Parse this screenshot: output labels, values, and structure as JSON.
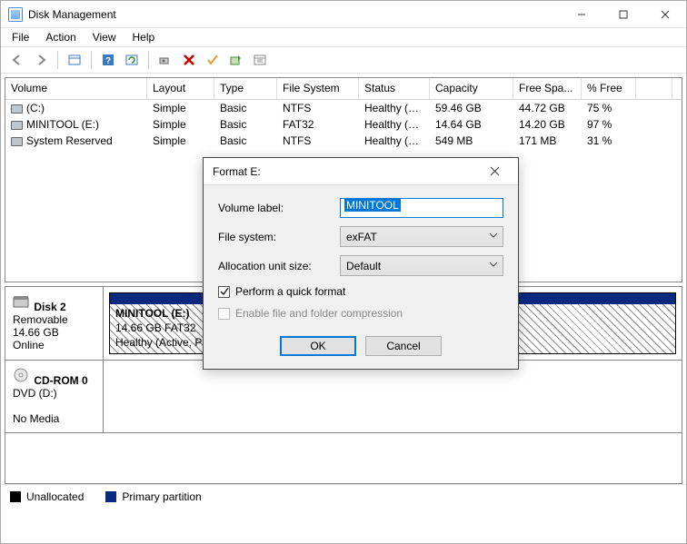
{
  "window": {
    "title": "Disk Management"
  },
  "menu": {
    "file": "File",
    "action": "Action",
    "view": "View",
    "help": "Help"
  },
  "columns": [
    "Volume",
    "Layout",
    "Type",
    "File System",
    "Status",
    "Capacity",
    "Free Spa...",
    "% Free"
  ],
  "volumes": [
    {
      "name": "(C:)",
      "layout": "Simple",
      "type": "Basic",
      "fs": "NTFS",
      "status": "Healthy (B...",
      "capacity": "59.46 GB",
      "free": "44.72 GB",
      "pct": "75 %"
    },
    {
      "name": "MINITOOL (E:)",
      "layout": "Simple",
      "type": "Basic",
      "fs": "FAT32",
      "status": "Healthy (A...",
      "capacity": "14.64 GB",
      "free": "14.20 GB",
      "pct": "97 %"
    },
    {
      "name": "System Reserved",
      "layout": "Simple",
      "type": "Basic",
      "fs": "NTFS",
      "status": "Healthy (S...",
      "capacity": "549 MB",
      "free": "171 MB",
      "pct": "31 %"
    }
  ],
  "disk_panel": {
    "disk2": {
      "title": "Disk 2",
      "kind": "Removable",
      "cap": "14.66 GB",
      "state": "Online",
      "part": {
        "label": "MINITOOL  (E:)",
        "size": "14.66 GB FAT32",
        "status": "Healthy (Active, Primary partition)"
      }
    },
    "cdrom": {
      "title": "CD-ROM 0",
      "kind": "DVD (D:)",
      "state": "No Media"
    }
  },
  "legend": {
    "unalloc": "Unallocated",
    "primary": "Primary partition",
    "unalloc_color": "#000000",
    "primary_color": "#0a2a80"
  },
  "dialog": {
    "title": "Format E:",
    "labels": {
      "vol": "Volume label:",
      "fs": "File system:",
      "alloc": "Allocation unit size:"
    },
    "values": {
      "vol": "MINITOOL",
      "fs": "exFAT",
      "alloc": "Default"
    },
    "chk_quick": "Perform a quick format",
    "chk_compress": "Enable file and folder compression",
    "quick_checked": true,
    "ok": "OK",
    "cancel": "Cancel"
  }
}
